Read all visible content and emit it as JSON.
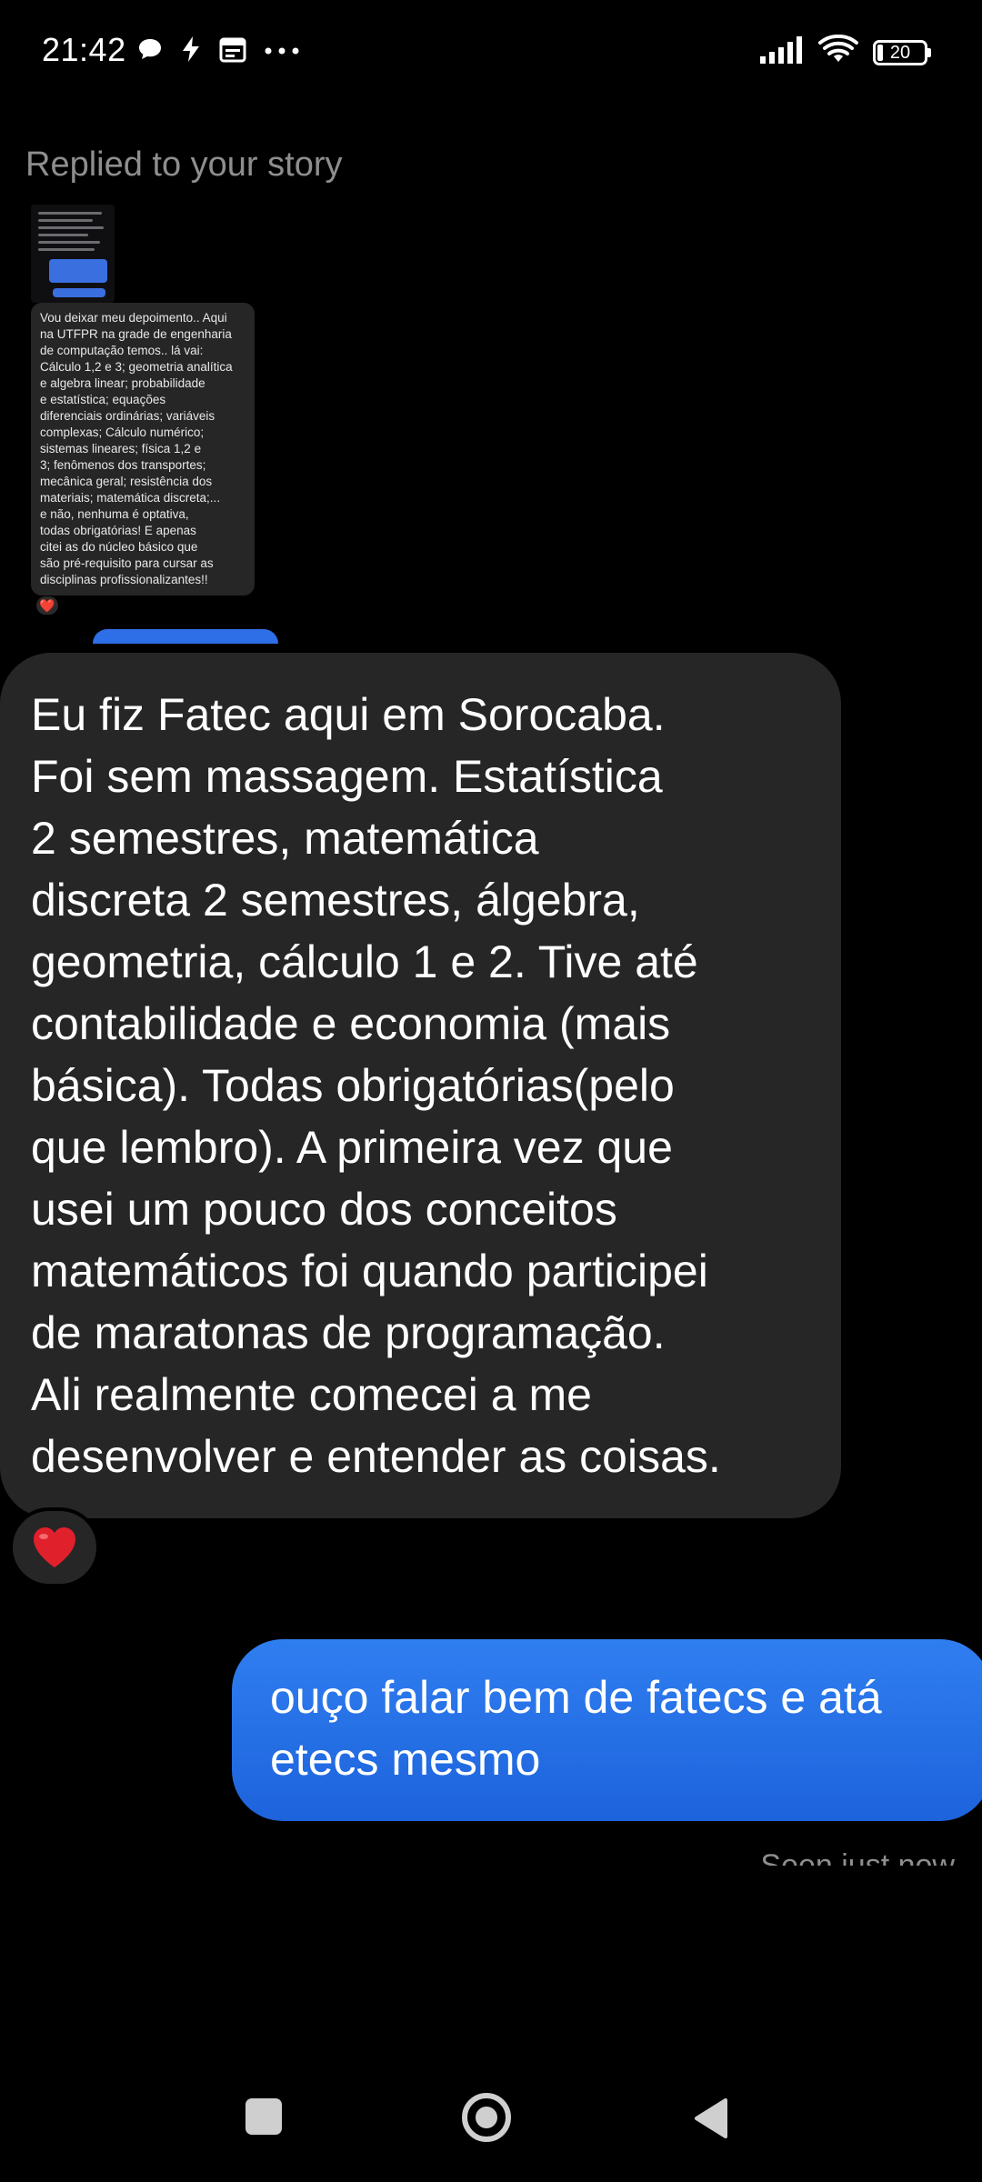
{
  "status_bar": {
    "time": "21:42",
    "battery": "20",
    "left_icons": [
      "chat-bubble-icon",
      "bolt-icon",
      "calendar-icon",
      "more-dots-icon"
    ],
    "right_icons": [
      "signal-icon",
      "wifi-icon",
      "battery-icon"
    ]
  },
  "story_reply": {
    "caption": "Replied to your story",
    "story_text": "Vou deixar meu depoimento.. Aqui\nna UTFPR na grade de engenharia\nde computação temos.. lá vai:\nCálculo 1,2 e 3; geometria analítica\ne algebra linear; probabilidade\ne estatística; equações\ndiferenciais ordinárias; variáveis\ncomplexas; Cálculo numérico;\nsistemas lineares; física 1,2 e\n3; fenômenos dos transportes;\nmecânica geral; resistência dos\nmateriais; matemática discreta;...\ne não, nenhuma é optativa,\ntodas obrigatórias! E apenas\ncitei as do núcleo básico que\nsão pré-requisito para cursar as\ndisciplinas profissionalizantes!!",
    "reaction": "❤️"
  },
  "received_message": {
    "text": "Eu fiz Fatec aqui em Sorocaba.\nFoi sem massagem. Estatística\n2 semestres, matemática\ndiscreta 2 semestres, álgebra,\ngeometria, cálculo 1 e 2. Tive até\ncontabilidade e economia (mais\nbásica). Todas obrigatórias(pelo\nque lembro). A primeira vez que\nusei um pouco dos conceitos\nmatemáticos foi quando participei\nde maratonas de programação.\nAli realmente comecei a me\ndesenvolver e entender as coisas.",
    "reaction": "❤️"
  },
  "sent_message": {
    "text": "ouço falar bem de fatecs e atá\netecs mesmo",
    "status": "Seen just now"
  },
  "colors": {
    "background": "#000000",
    "received_bubble": "#262626",
    "sent_bubble": "#1d63dc",
    "muted_text": "#8e8e8e"
  }
}
